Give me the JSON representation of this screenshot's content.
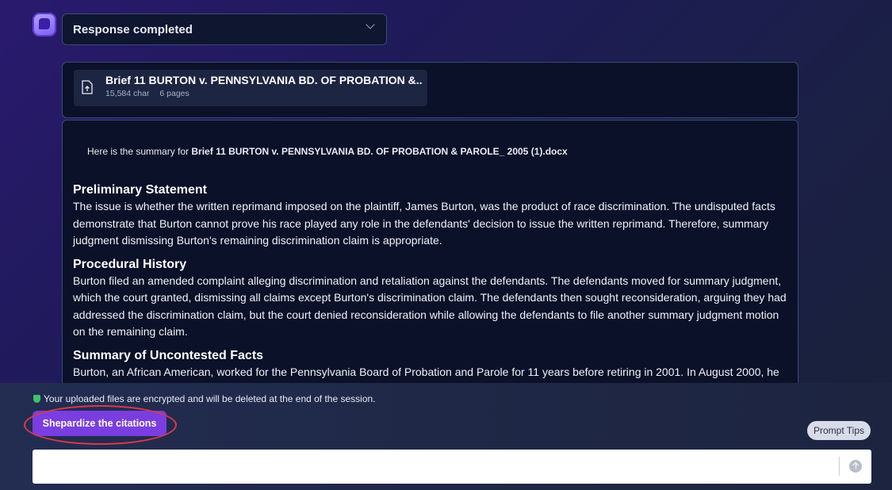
{
  "status": {
    "label": "Response completed",
    "icon": "chevron-down-icon"
  },
  "file": {
    "name": "Brief 11 BURTON v. PENNSYLVANIA BD. OF PROBATION &...",
    "chars": "15,584 char",
    "pages": "6 pages",
    "icon": "file-upload-icon"
  },
  "summary": {
    "intro_prefix": "Here is the summary for",
    "intro_file": "Brief 11 BURTON v. PENNSYLVANIA BD. OF PROBATION & PAROLE_ 2005 (1).docx",
    "sections": [
      {
        "heading": "Preliminary Statement",
        "body": "The issue is whether the written reprimand imposed on the plaintiff, James Burton, was the product of race discrimination. The undisputed facts demonstrate that Burton cannot prove his race played any role in the defendants' decision to issue the written reprimand. Therefore, summary judgment dismissing Burton's remaining discrimination claim is appropriate."
      },
      {
        "heading": "Procedural History",
        "body": "Burton filed an amended complaint alleging discrimination and retaliation against the defendants. The defendants moved for summary judgment, which the court granted, dismissing all claims except Burton's discrimination claim. The defendants then sought reconsideration, arguing they had addressed the discrimination claim, but the court denied reconsideration while allowing the defendants to file another summary judgment motion on the remaining claim."
      },
      {
        "heading": "Summary of Uncontested Facts",
        "body": "Burton, an African American, worked for the Pennsylvania Board of Probation and Parole for 11 years before retiring in 2001. In August 2000, he"
      }
    ]
  },
  "footer": {
    "encryption_note": "Your uploaded files are encrypted and will be deleted at the end of the session.",
    "shepardize_label": "Shepardize the citations",
    "prompt_tips_label": "Prompt Tips",
    "input_placeholder": "",
    "send_icon": "arrow-up-icon"
  },
  "colors": {
    "accent": "#7a3ee0",
    "highlight": "#d93a4a",
    "panel": "#0a1128",
    "border": "#3b4a72"
  }
}
